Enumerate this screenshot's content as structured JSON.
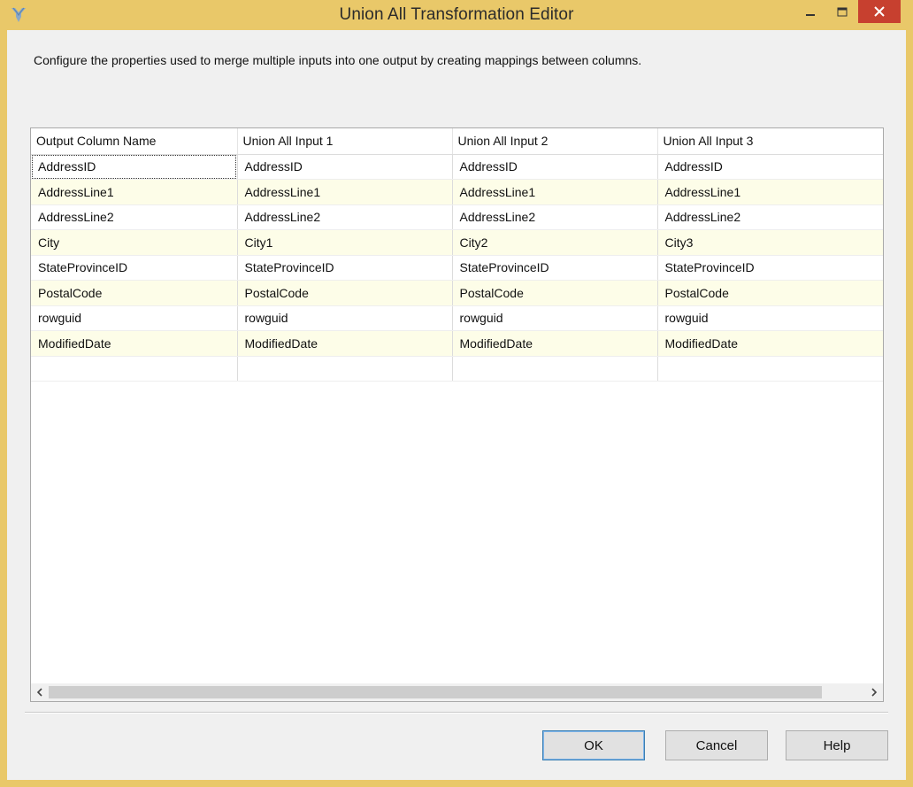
{
  "window": {
    "title": "Union All Transformation Editor",
    "icon": "union-all-icon",
    "controls": {
      "minimize": "minimize-icon",
      "maximize": "maximize-icon",
      "close": "close-icon"
    }
  },
  "description": "Configure the properties used to merge multiple inputs into one output by creating mappings between columns.",
  "grid": {
    "columns": [
      "Output Column Name",
      "Union All Input 1",
      "Union All Input 2",
      "Union All Input 3"
    ],
    "rows": [
      [
        "AddressID",
        "AddressID",
        "AddressID",
        "AddressID"
      ],
      [
        "AddressLine1",
        "AddressLine1",
        "AddressLine1",
        "AddressLine1"
      ],
      [
        "AddressLine2",
        "AddressLine2",
        "AddressLine2",
        "AddressLine2"
      ],
      [
        "City",
        "City1",
        "City2",
        "City3"
      ],
      [
        "StateProvinceID",
        "StateProvinceID",
        "StateProvinceID",
        "StateProvinceID"
      ],
      [
        "PostalCode",
        "PostalCode",
        "PostalCode",
        "PostalCode"
      ],
      [
        "rowguid",
        "rowguid",
        "rowguid",
        "rowguid"
      ],
      [
        "ModifiedDate",
        "ModifiedDate",
        "ModifiedDate",
        "ModifiedDate"
      ],
      [
        "",
        "",
        "",
        ""
      ]
    ]
  },
  "buttons": {
    "ok": "OK",
    "cancel": "Cancel",
    "help": "Help"
  },
  "colors": {
    "frame": "#e9c869",
    "close": "#c7402f",
    "alt_row": "#fdfde8"
  }
}
